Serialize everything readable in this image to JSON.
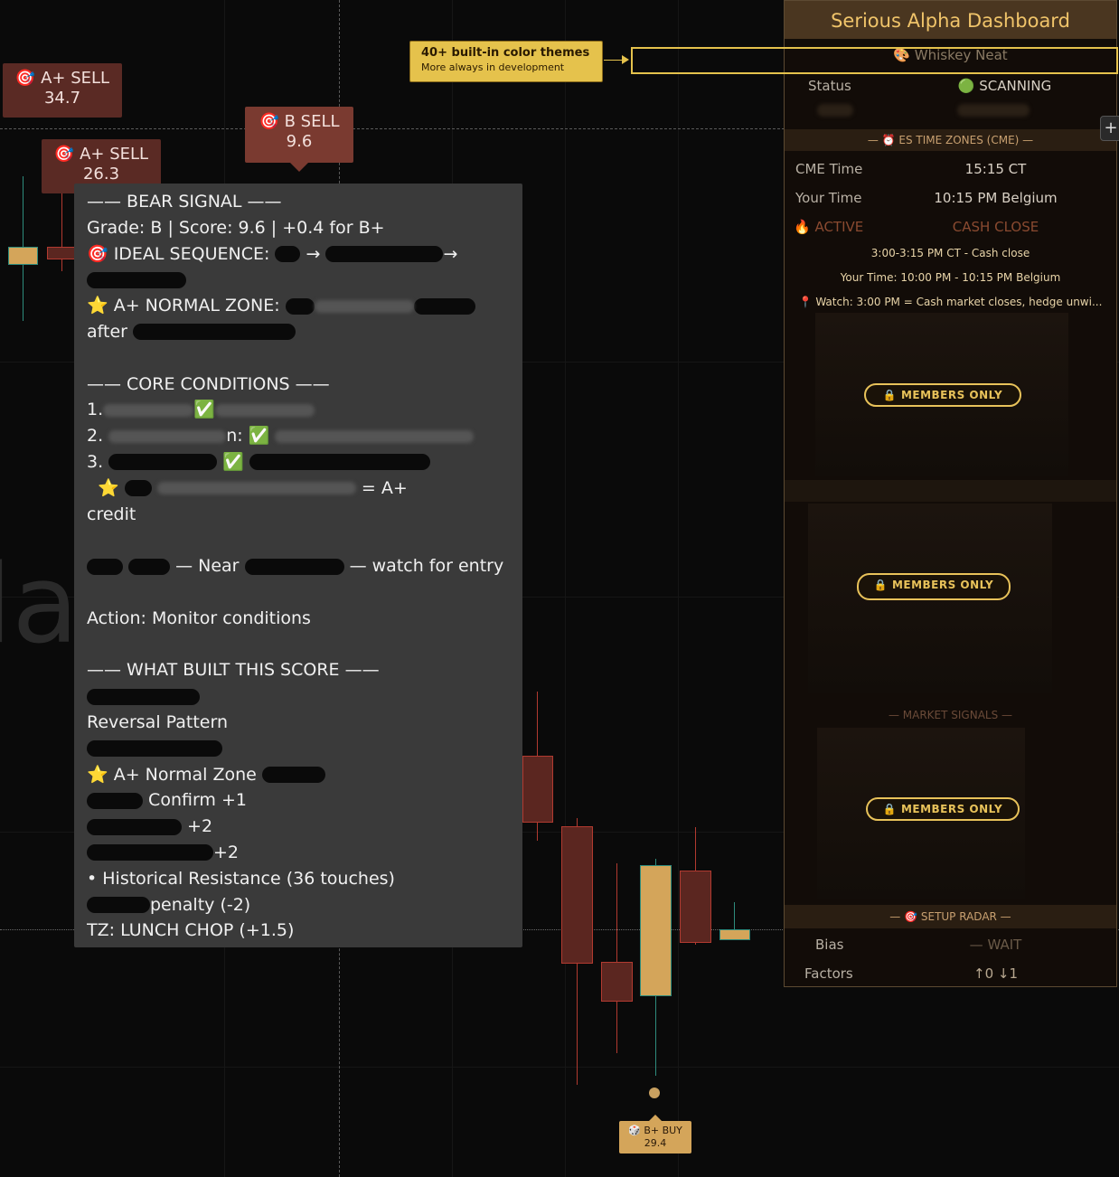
{
  "chart": {
    "watermark": "la",
    "signals": [
      {
        "icon": "🎯",
        "label": "A+ SELL",
        "value": "34.7"
      },
      {
        "icon": "🎯",
        "label": "A+ SELL",
        "value": "26.3"
      },
      {
        "icon": "🎯",
        "label": "B SELL",
        "value": "9.6"
      }
    ],
    "buy_signal": {
      "icon": "🎲",
      "label": "B+ BUY",
      "value": "29.4"
    }
  },
  "tooltip": {
    "header": "—— BEAR SIGNAL ——",
    "grade_line": "Grade: B | Score: 9.6 | +0.4 for B+",
    "ideal_sequence_label": "🎯 IDEAL SEQUENCE:",
    "arrow": "→",
    "normal_zone_label": "⭐ A+ NORMAL ZONE:",
    "after": "after",
    "core_header": "—— CORE CONDITIONS ——",
    "cond1": "1.",
    "cond2": "2.",
    "cond2_suffix": "n:",
    "cond3": "3.",
    "check": "✅",
    "star": "⭐",
    "a_plus_suffix": "= A+",
    "credit": "credit",
    "near_label": "— Near",
    "watch_label": "— watch for entry",
    "action": "Action: Monitor conditions",
    "built_header": "—— WHAT BUILT THIS SCORE ——",
    "reversal": "Reversal Pattern",
    "normal_zone_item": "⭐ A+ Normal Zone",
    "confirm": "Confirm +1",
    "plus2a": "+2",
    "plus2b": "+2",
    "historical": "• Historical Resistance (36 touches)",
    "penalty": "penalty (-2)",
    "tz": "TZ: LUNCH CHOP (+1.5)"
  },
  "callout": {
    "title": "40+ built-in color themes",
    "subtitle": "More always in development"
  },
  "dashboard": {
    "title": "Serious Alpha Dashboard",
    "theme": "🎨 Whiskey Neat",
    "status_label": "Status",
    "status_value": "🟢 SCANNING",
    "timezones_header": "— ⏰ ES TIME ZONES (CME) —",
    "cme_time_label": "CME Time",
    "cme_time_value": "15:15 CT",
    "your_time_label": "Your Time",
    "your_time_value": "10:15 PM Belgium",
    "active_label": "🔥 ACTIVE",
    "active_value": "CASH CLOSE",
    "cash_close_range": "3:00-3:15 PM CT - Cash close",
    "your_time_range": "Your Time: 10:00 PM - 10:15 PM Belgium",
    "watch_note": "📍 Watch: 3:00 PM = Cash market closes, hedge unwi...",
    "members_only": "🔒 MEMBERS ONLY",
    "market_signals_header": "— MARKET SIGNALS —",
    "setup_radar_header": "— 🎯 SETUP RADAR —",
    "bias_label": "Bias",
    "bias_value": "— WAIT",
    "factors_label": "Factors",
    "factors_value": "↑0 ↓1"
  },
  "colors": {
    "accent": "#e5c24c",
    "bear": "#b23a30",
    "bull": "#d4a55a",
    "panel": "#3a3a3a"
  }
}
